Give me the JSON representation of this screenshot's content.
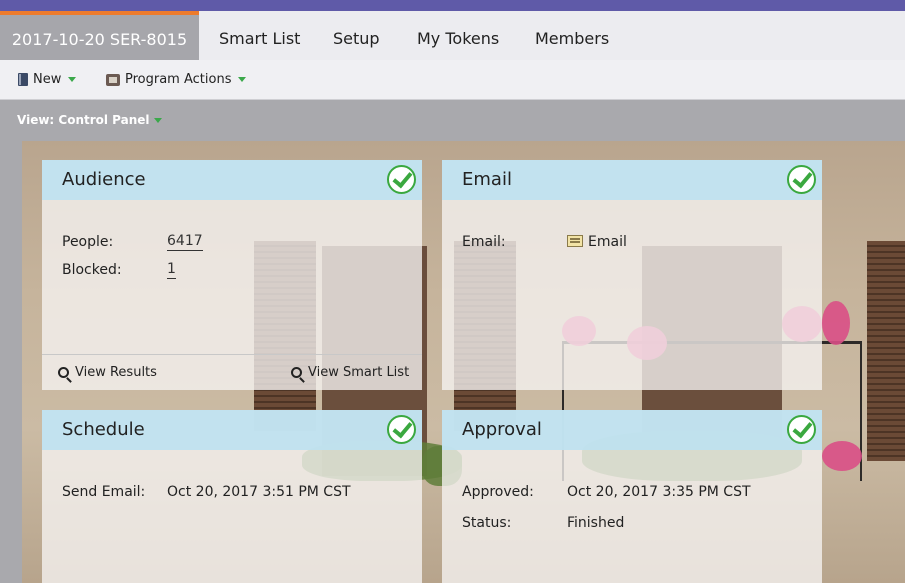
{
  "tabs": [
    {
      "label": "2017-10-20 SER-8015",
      "active": true
    },
    {
      "label": "Smart List"
    },
    {
      "label": "Setup"
    },
    {
      "label": "My Tokens"
    },
    {
      "label": "Members"
    }
  ],
  "toolbar": {
    "new_label": "New",
    "program_actions_label": "Program Actions"
  },
  "view": {
    "label": "View: Control Panel"
  },
  "audience": {
    "title": "Audience",
    "people_label": "People:",
    "people_value": "6417",
    "blocked_label": "Blocked:",
    "blocked_value": "1",
    "view_results": "View Results",
    "view_smart_list": "View Smart List"
  },
  "email": {
    "title": "Email",
    "email_label": "Email:",
    "email_value": "Email"
  },
  "schedule": {
    "title": "Schedule",
    "send_email_label": "Send Email:",
    "send_email_value": "Oct 20, 2017 3:51 PM CST"
  },
  "approval": {
    "title": "Approval",
    "approved_label": "Approved:",
    "approved_value": "Oct 20, 2017 3:35 PM CST",
    "status_label": "Status:",
    "status_value": "Finished"
  },
  "colors": {
    "top_bar": "#5f5aa8",
    "active_tab_accent": "#ed7b2c",
    "panel_header": "#bee2f0",
    "check_green": "#3aa83f",
    "dropdown_caret": "#3aa84a"
  },
  "icons": [
    "book-icon",
    "box-icon",
    "dropdown-caret-icon",
    "check-icon",
    "magnifier-icon",
    "email-icon"
  ]
}
